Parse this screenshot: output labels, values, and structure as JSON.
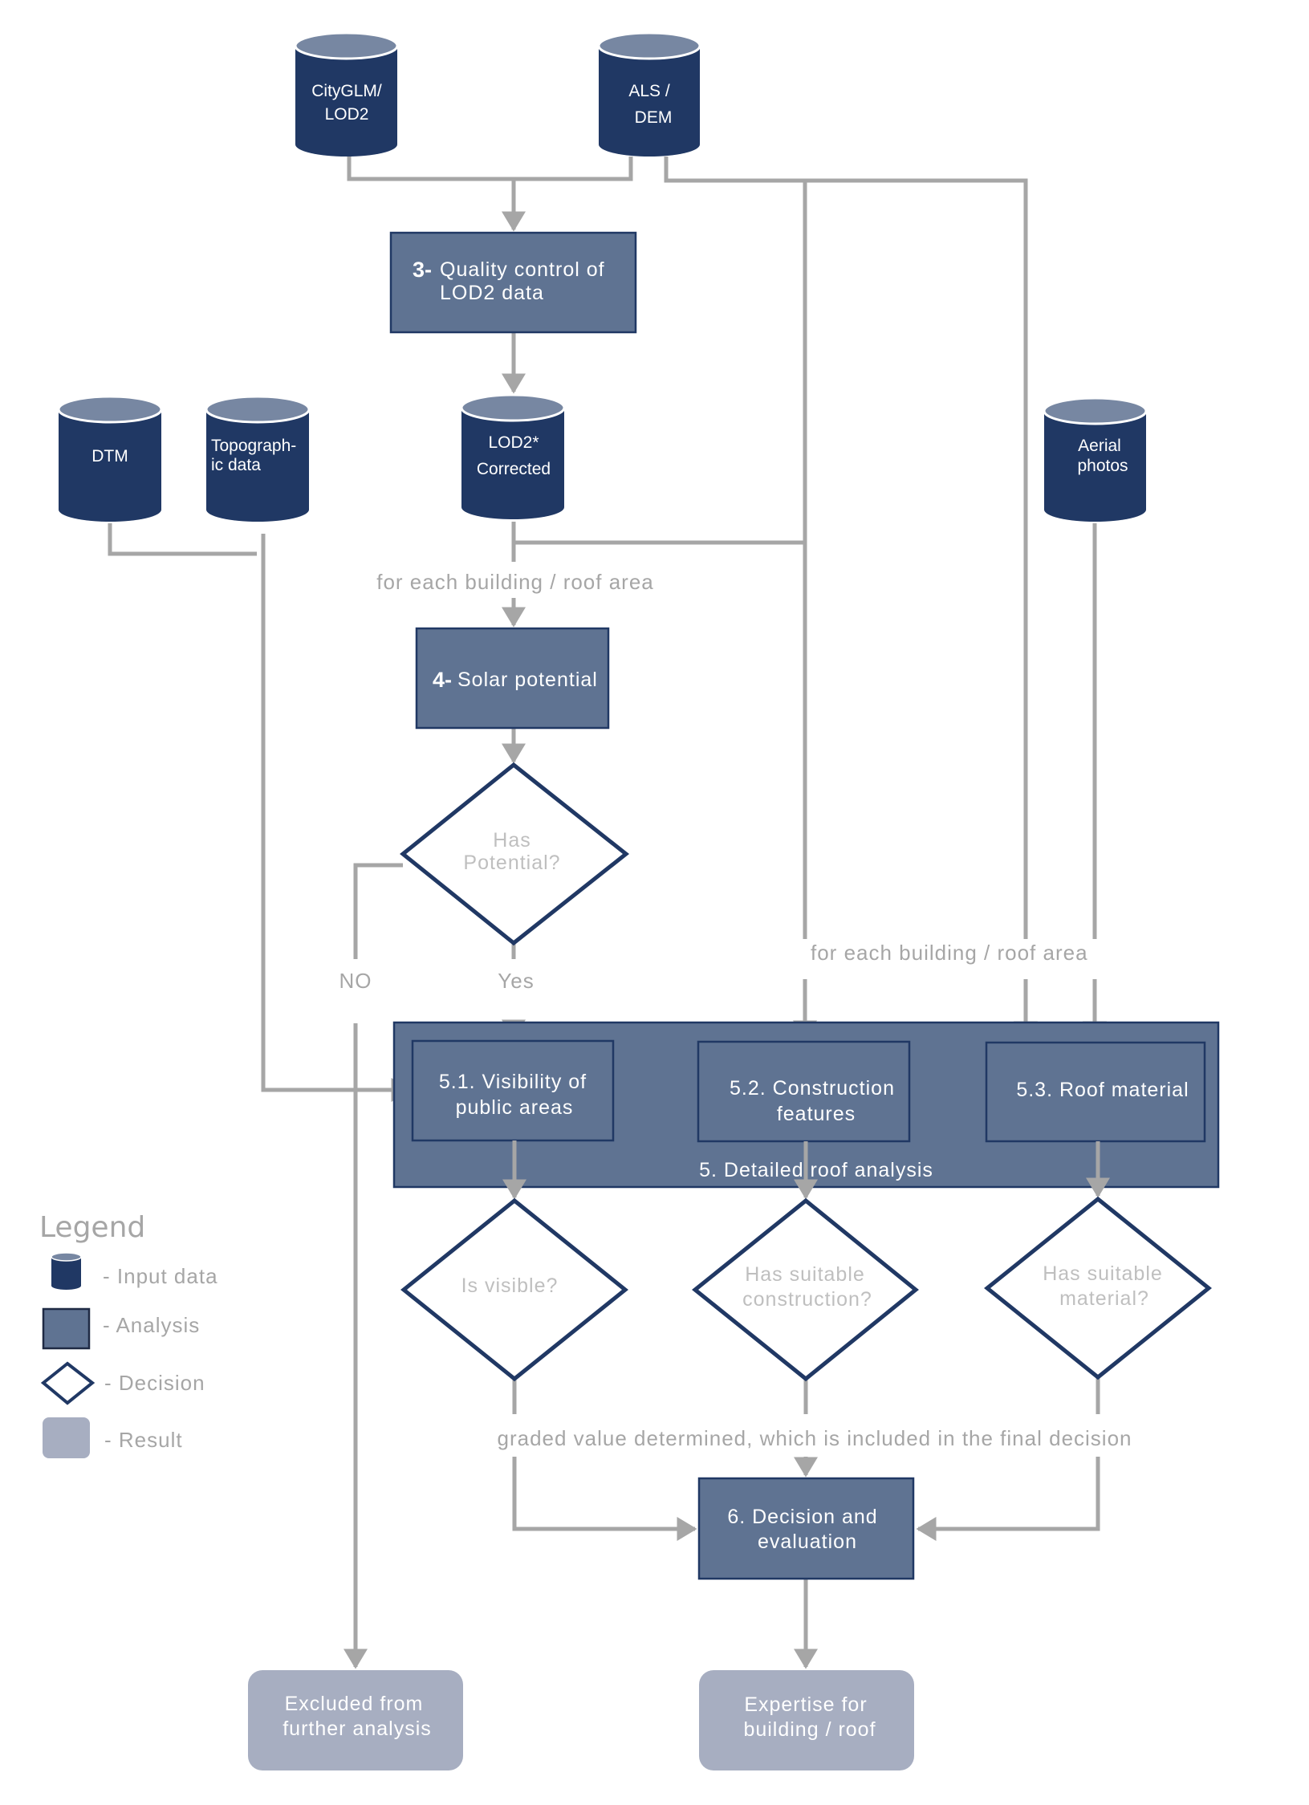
{
  "inputs": {
    "citygml": {
      "line1": "CityGLM/",
      "line2": "LOD2"
    },
    "als": {
      "line1": "ALS /",
      "line2": "DEM"
    },
    "dtm": {
      "line1": "DTM"
    },
    "topo": {
      "line1": "Topograph-",
      "line2": "ic data"
    },
    "lod2_corrected": {
      "line1": "LOD2*",
      "line2": "Corrected"
    },
    "aerial": {
      "line1": "Aerial",
      "line2": "photos"
    }
  },
  "analysis": {
    "quality_control": {
      "num": "3-",
      "line1": "Quality control of",
      "line2": "LOD2 data"
    },
    "solar_potential": {
      "num": "4-",
      "line1": "Solar potential"
    },
    "detailed_roof": {
      "label": "5. Detailed roof analysis"
    },
    "visibility": {
      "line1": "5.1. Visibility of",
      "line2": "public areas"
    },
    "construction": {
      "line1": "5.2. Construction",
      "line2": "features"
    },
    "roof_material": {
      "line1": "5.3. Roof material"
    },
    "decision_eval": {
      "line1": "6.  Decision and",
      "line2": "evaluation"
    }
  },
  "decisions": {
    "has_potential": {
      "line1": "Has",
      "line2": "Potential?"
    },
    "is_visible": {
      "line1": "Is visible?"
    },
    "suitable_construction": {
      "line1": "Has suitable",
      "line2": "construction?"
    },
    "suitable_material": {
      "line1": "Has suitable",
      "line2": "material?"
    }
  },
  "labels": {
    "for_each_1": "for each building / roof area",
    "for_each_2": "for each building / roof area",
    "no": "NO",
    "yes": "Yes",
    "graded": "graded value determined, which is included in the final decision"
  },
  "results": {
    "excluded": {
      "line1": "Excluded from",
      "line2": "further analysis"
    },
    "expertise": {
      "line1": "Expertise for",
      "line2": "building / roof"
    }
  },
  "legend": {
    "title": "Legend",
    "items": [
      {
        "shape": "cylinder",
        "label": "- Input data"
      },
      {
        "shape": "rectangle",
        "label": "- Analysis"
      },
      {
        "shape": "diamond",
        "label": "- Decision"
      },
      {
        "shape": "rounded-rectangle",
        "label": "- Result"
      }
    ]
  },
  "colors": {
    "input": "#203864",
    "input_top": "#7787a2",
    "analysis": "#5f7392",
    "result": "#a7aec1",
    "connector": "#a6a6a6",
    "decision_border": "#203864"
  }
}
